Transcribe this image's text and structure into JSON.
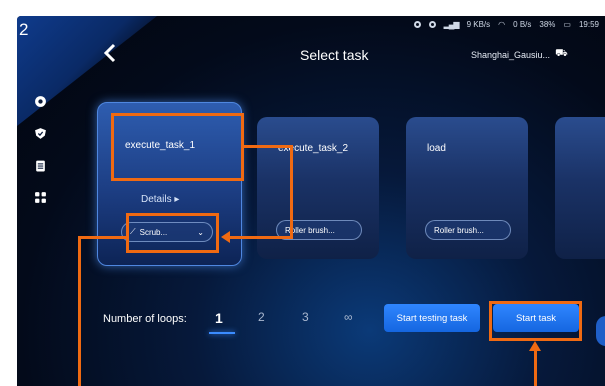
{
  "step_number": "2",
  "status": {
    "network_speed_1": "9",
    "network_unit_1": "KB/s",
    "network_speed_2": "0",
    "network_unit_2": "B/s",
    "battery": "38%",
    "time": "19:59"
  },
  "header": {
    "back_icon": "chevron-left-icon",
    "title": "Select task",
    "location": "Shanghai_Gausiu...",
    "location_icon": "robot-icon"
  },
  "sidebar": {
    "items": [
      "location-icon",
      "shield-icon",
      "clipboard-icon",
      "grid-icon"
    ]
  },
  "tasks": [
    {
      "name": "execute_task_1",
      "details": "Details",
      "mode": "Scrub...",
      "selected": true
    },
    {
      "name": "execute_task_2",
      "mode": "Roller brush..."
    },
    {
      "name": "load",
      "mode": "Roller brush..."
    }
  ],
  "loops": {
    "label": "Number of loops:",
    "options": [
      "1",
      "2",
      "3",
      "∞"
    ],
    "selected": "1"
  },
  "buttons": {
    "start_testing": "Start testing task",
    "start": "Start task"
  },
  "colors": {
    "highlight": "#f06a12",
    "accent": "#2f86ff"
  }
}
